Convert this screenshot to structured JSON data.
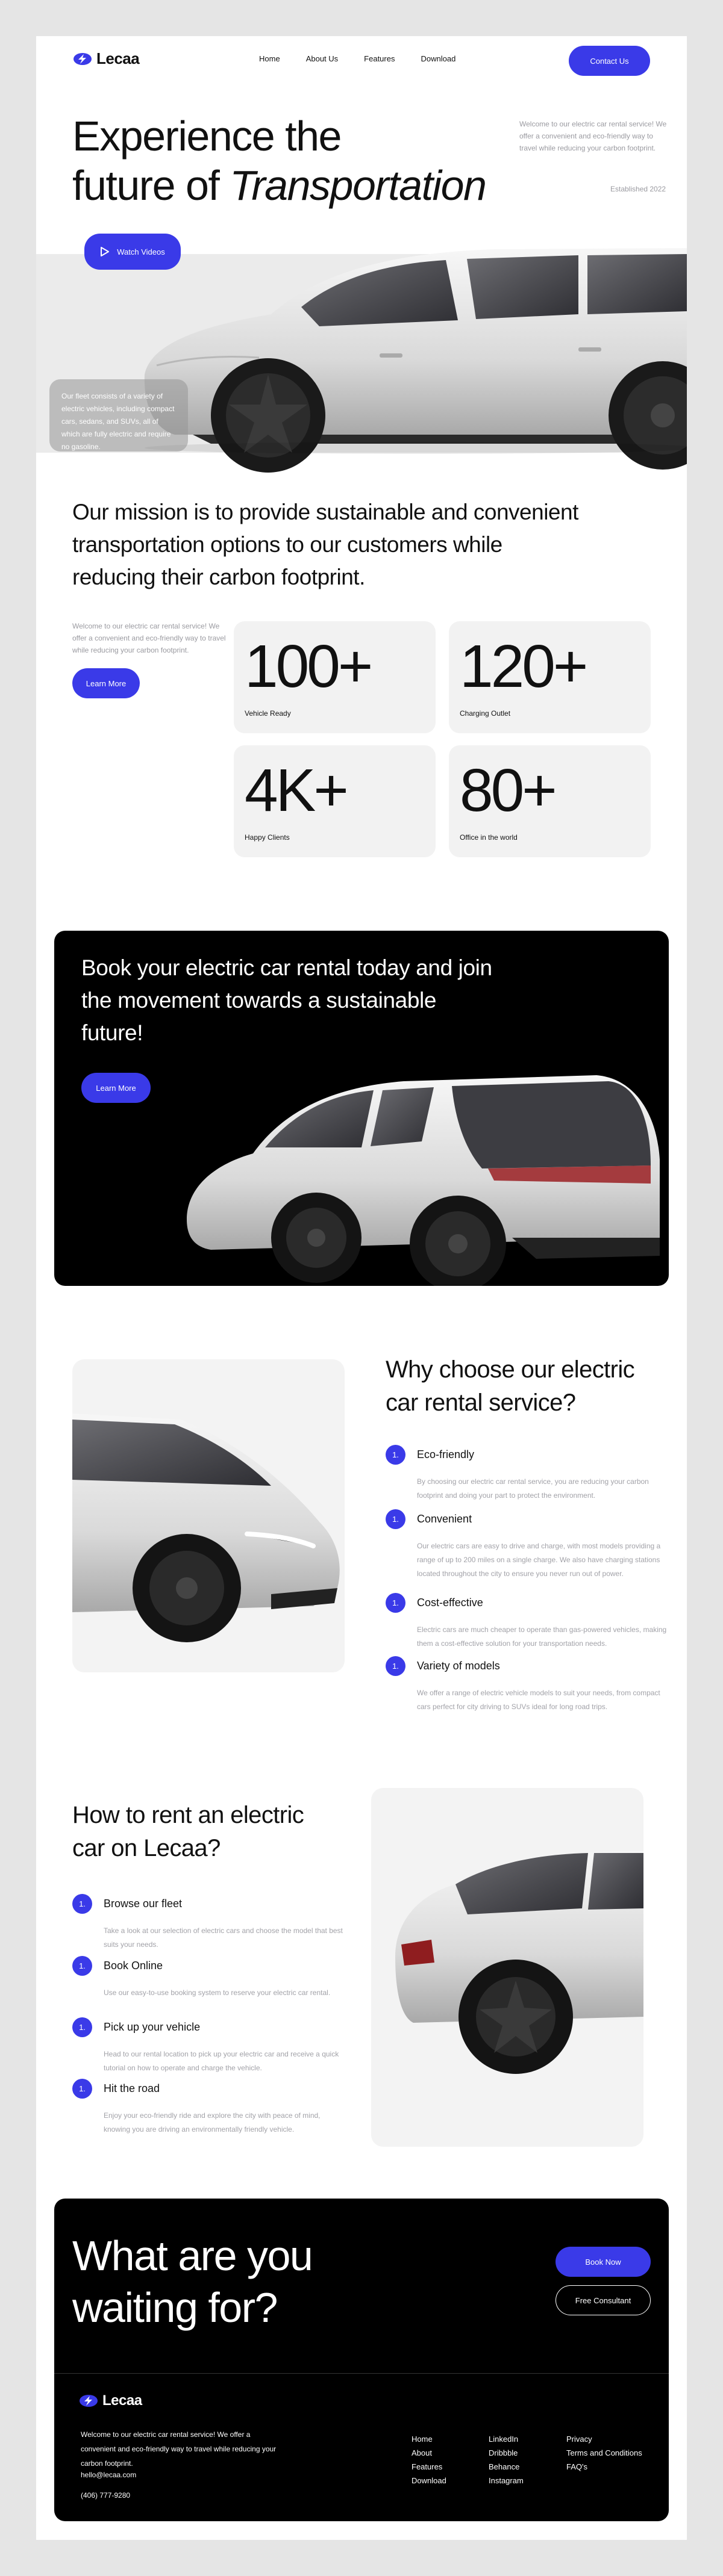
{
  "nav": {
    "logo": "Lecaa",
    "links": [
      "Home",
      "About Us",
      "Features",
      "Download"
    ],
    "contact": "Contact Us"
  },
  "hero": {
    "title_line1": "Experience the",
    "title_line2_plain": "future of ",
    "title_line2_italic": "Transportation",
    "side_text": "Welcome to our electric car rental service! We offer a convenient and eco-friendly way to travel while reducing your carbon footprint.",
    "established": "Established 2022",
    "watch_videos": "Watch Videos",
    "note": "Our fleet consists of a variety of electric vehicles, including compact cars, sedans, and SUVs, all of which are fully electric and require no gasoline."
  },
  "mission": {
    "text": "Our mission is to provide sustainable and convenient transportation options to our customers while reducing their carbon footprint.",
    "side_text": "Welcome to our electric car rental service! We offer a convenient and eco-friendly way to travel while reducing your carbon footprint.",
    "learn_more": "Learn More",
    "stats": [
      {
        "value": "100+",
        "label": "Vehicle Ready"
      },
      {
        "value": "120+",
        "label": "Charging Outlet"
      },
      {
        "value": "4K+",
        "label": "Happy Clients"
      },
      {
        "value": "80+",
        "label": "Office in the world"
      }
    ]
  },
  "book": {
    "title": "Book your electric car rental today and join the movement towards a sustainable future!",
    "learn_more": "Learn More"
  },
  "why": {
    "title": "Why choose our electric car rental service?",
    "items": [
      {
        "num": "1.",
        "title": "Eco-friendly",
        "desc": "By choosing our electric car rental service, you are reducing your carbon footprint and doing your part to protect the environment."
      },
      {
        "num": "1.",
        "title": "Convenient",
        "desc": "Our electric cars are easy to drive and charge, with most models providing a range of up to 200 miles on a single charge. We also have charging stations located throughout the city to ensure you never run out of power."
      },
      {
        "num": "1.",
        "title": "Cost-effective",
        "desc": "Electric cars are much cheaper to operate than gas-powered vehicles, making them a cost-effective solution for your transportation needs."
      },
      {
        "num": "1.",
        "title": "Variety of models",
        "desc": "We offer a range of electric vehicle models to suit your needs, from compact cars perfect for city driving to SUVs ideal for long road trips."
      }
    ]
  },
  "howto": {
    "title": "How to rent an electric car on Lecaa?",
    "steps": [
      {
        "num": "1.",
        "title": "Browse our fleet",
        "desc": "Take a look at our selection of electric cars and choose the model that best suits your needs."
      },
      {
        "num": "1.",
        "title": "Book Online",
        "desc": "Use our easy-to-use booking system to reserve your electric car rental."
      },
      {
        "num": "1.",
        "title": "Pick up your vehicle",
        "desc": "Head to our rental location to pick up your electric car and receive a quick tutorial on how to operate and charge the vehicle."
      },
      {
        "num": "1.",
        "title": "Hit the road",
        "desc": "Enjoy your eco-friendly ride and explore the city with peace of mind, knowing you are driving an environmentally friendly vehicle."
      }
    ]
  },
  "cta": {
    "line1": "What are you",
    "line2": "waiting for?",
    "book_now": "Book Now",
    "free_consultant": "Free Consultant"
  },
  "footer": {
    "logo": "Lecaa",
    "text": "Welcome to our electric car rental service! We offer a convenient and eco-friendly way to travel while reducing your carbon footprint.",
    "email": "hello@lecaa.com",
    "phone": "(406) 777-9280",
    "col1": [
      "Home",
      "About",
      "Features",
      "Download"
    ],
    "col2": [
      "LinkedIn",
      "Dribbble",
      "Behance",
      "Instagram"
    ],
    "col3": [
      "Privacy",
      "Terms and Conditions",
      "FAQ's"
    ]
  },
  "colors": {
    "accent": "#3a3ae8",
    "dark": "#000000",
    "panel": "#f2f2f2",
    "muted": "#9a9aa0"
  }
}
